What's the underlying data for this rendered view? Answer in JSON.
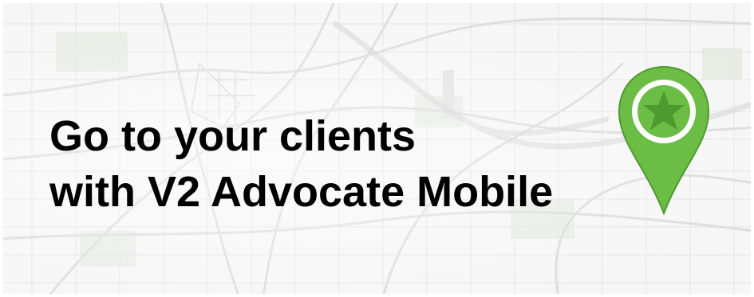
{
  "banner": {
    "headline_line1": "Go to your clients",
    "headline_line2": "with V2 Advocate Mobile",
    "pin_icon": "map-pin-star-icon",
    "colors": {
      "pin_green": "#6cbd45",
      "pin_green_dark": "#4e9a31",
      "text": "#000000",
      "map_roads": "#dadada",
      "map_bg": "#f6f6f6"
    }
  }
}
